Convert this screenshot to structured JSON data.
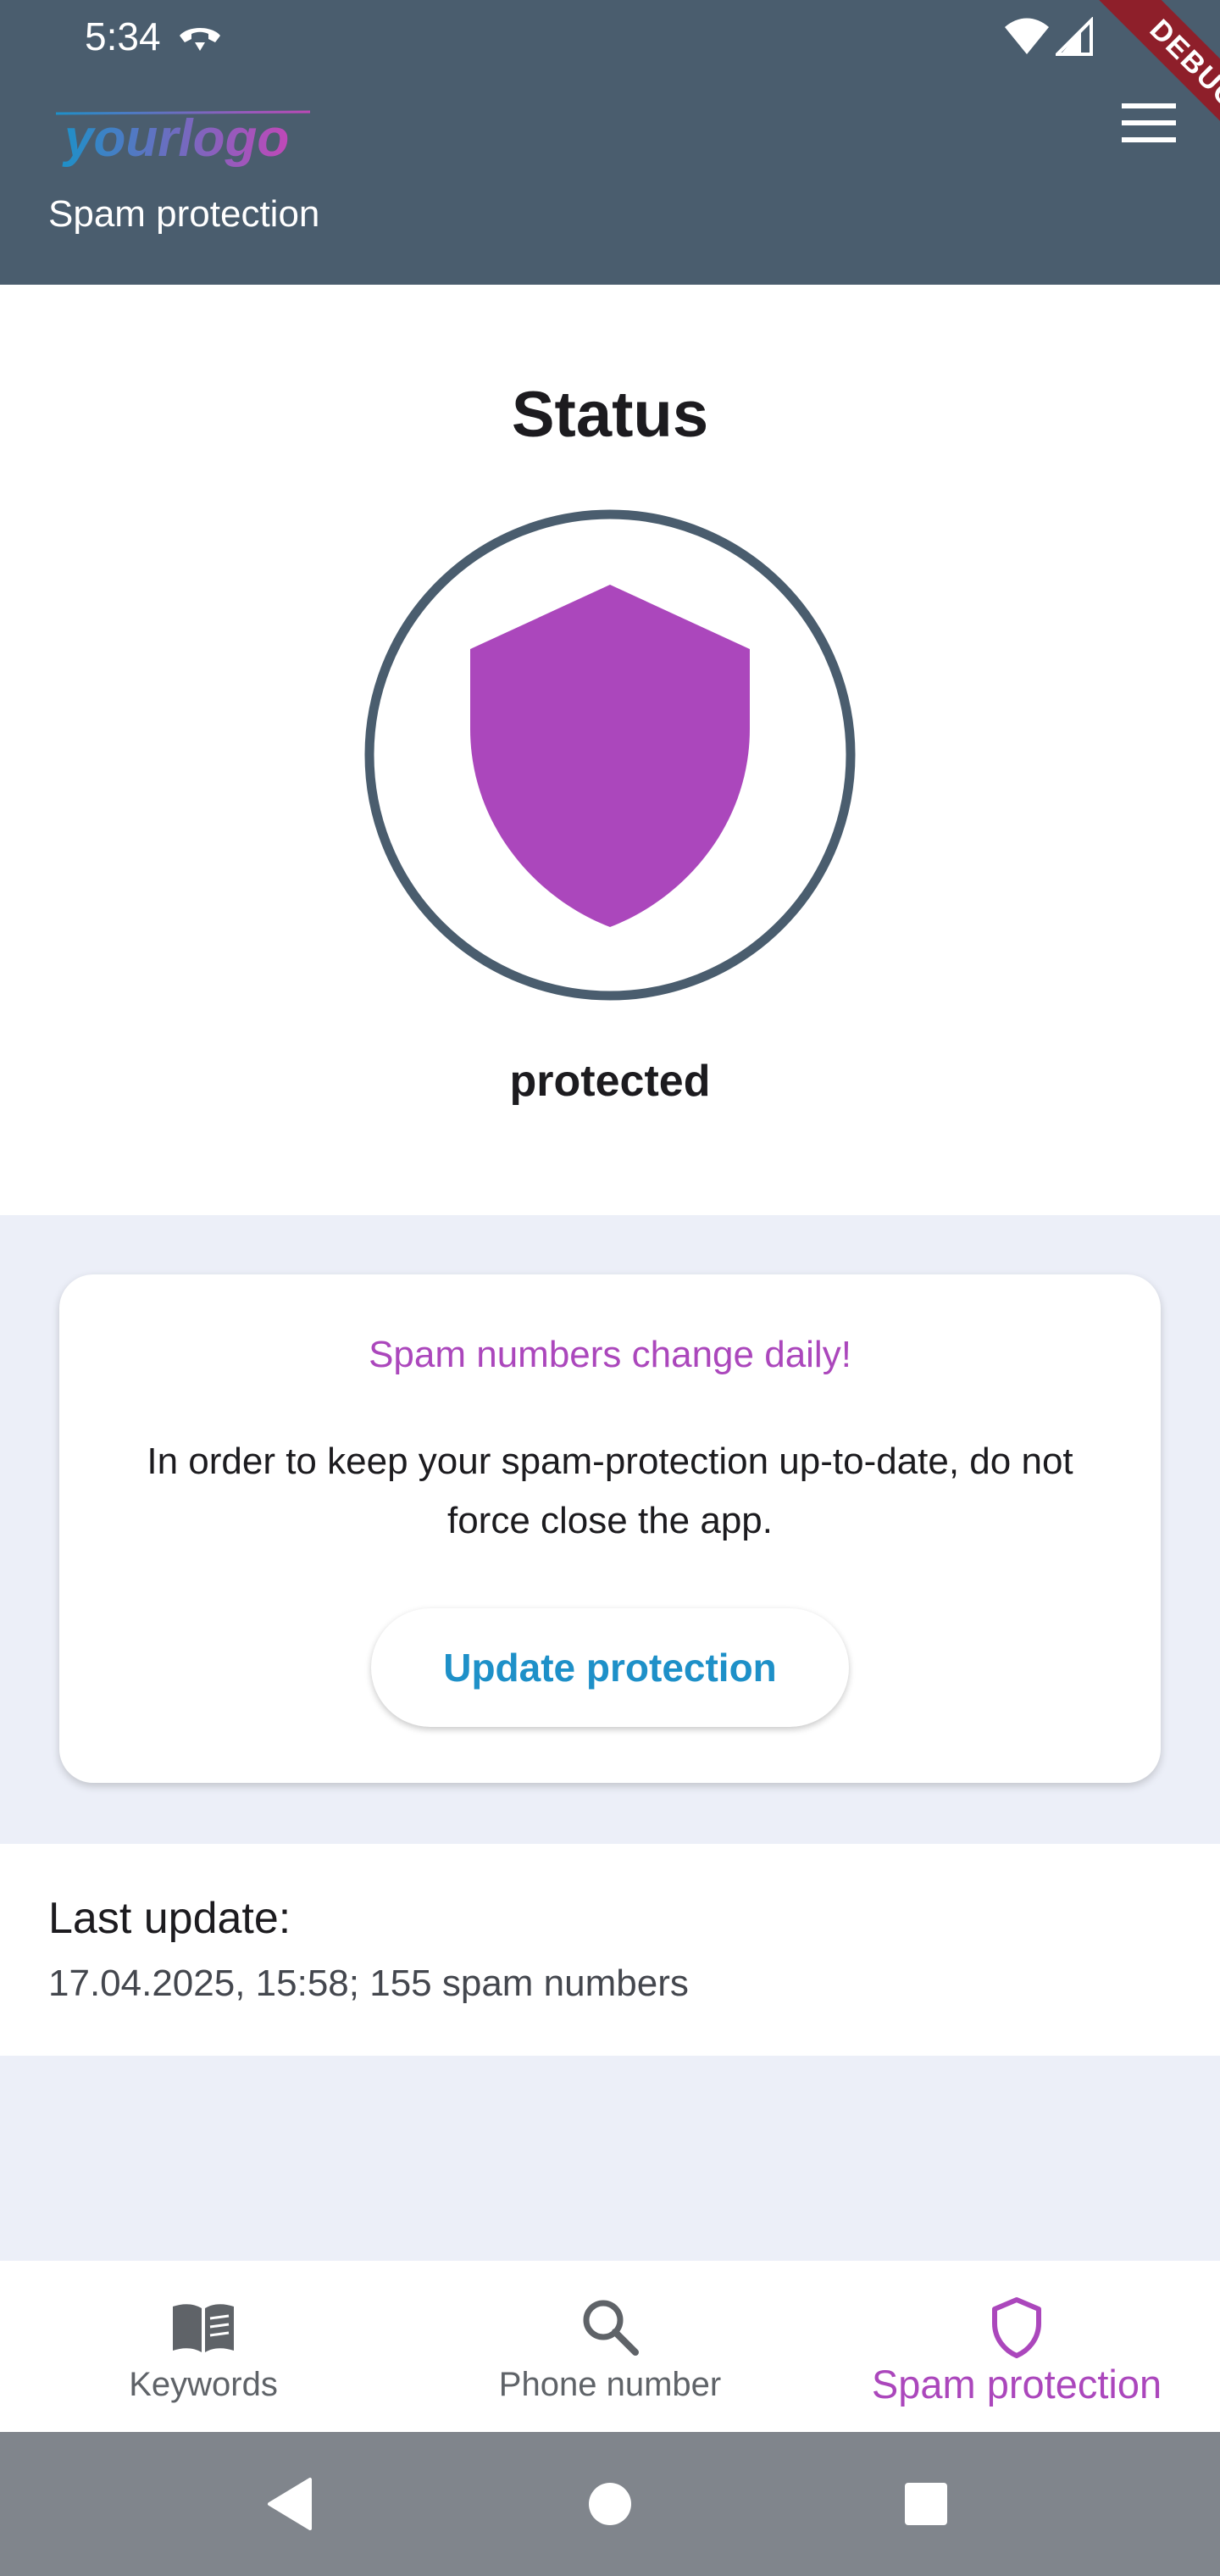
{
  "status_bar": {
    "time": "5:34"
  },
  "app_bar": {
    "logo_text": "yourlogo",
    "title": "Spam protection",
    "debug_label": "DEBUG"
  },
  "status": {
    "heading": "Status",
    "value": "protected"
  },
  "card": {
    "headline": "Spam numbers change daily!",
    "body": "In order to keep your spam-protection up-to-date, do not force close the app.",
    "button_label": "Update protection"
  },
  "last_update": {
    "label": "Last update:",
    "value": "17.04.2025, 15:58; 155 spam numbers"
  },
  "bottom_nav": {
    "items": [
      {
        "label": "Keywords",
        "icon": "book-icon",
        "active": false
      },
      {
        "label": "Phone number",
        "icon": "search-icon",
        "active": false
      },
      {
        "label": "Spam protection",
        "icon": "shield-outline-icon",
        "active": true
      }
    ]
  },
  "colors": {
    "app_bar": "#4a5d6e",
    "accent_purple": "#ab47bc",
    "accent_blue": "#1e90c8",
    "info_background": "#eceff8",
    "debug_ribbon": "#8e1f2a"
  },
  "icons": {
    "status_call": "call-end-icon",
    "status_wifi": "wifi-icon",
    "status_signal": "cell-signal-icon",
    "menu": "hamburger-menu-icon",
    "status_shield": "shield-icon",
    "system_back": "back-triangle-icon",
    "system_home": "home-circle-icon",
    "system_recents": "recents-square-icon"
  }
}
